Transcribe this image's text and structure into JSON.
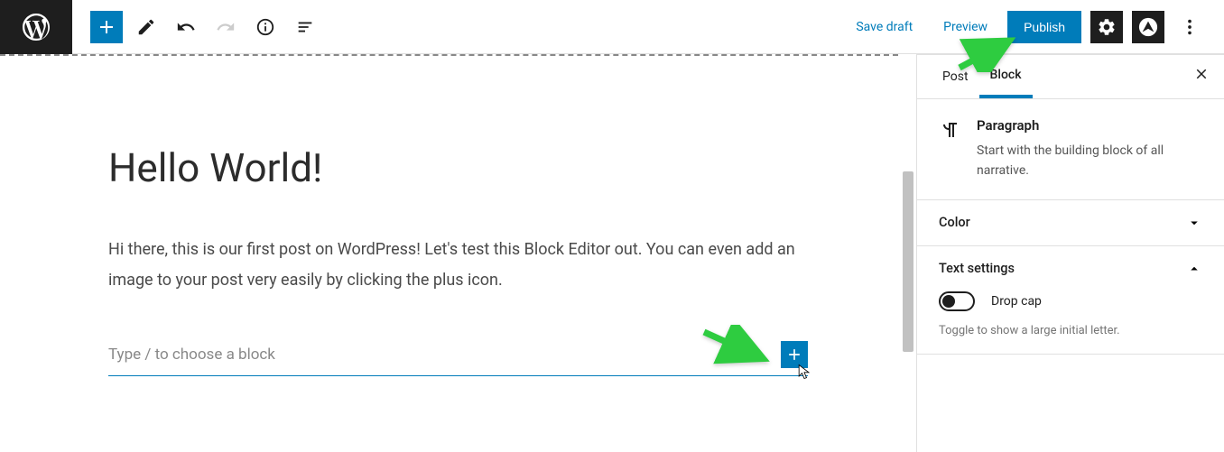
{
  "header": {
    "save_draft": "Save draft",
    "preview": "Preview",
    "publish": "Publish"
  },
  "post": {
    "title": "Hello World!",
    "body": "Hi there, this is our first post on WordPress! Let's test this Block Editor out. You can even add an image to your post very easily by clicking the plus icon.",
    "placeholder": "Type / to choose a block"
  },
  "sidebar": {
    "tabs": {
      "post": "Post",
      "block": "Block"
    },
    "block_info": {
      "title": "Paragraph",
      "desc": "Start with the building block of all narrative."
    },
    "panels": {
      "color": "Color",
      "text_settings": "Text settings"
    },
    "drop_cap_label": "Drop cap",
    "drop_cap_hint": "Toggle to show a large initial letter."
  }
}
